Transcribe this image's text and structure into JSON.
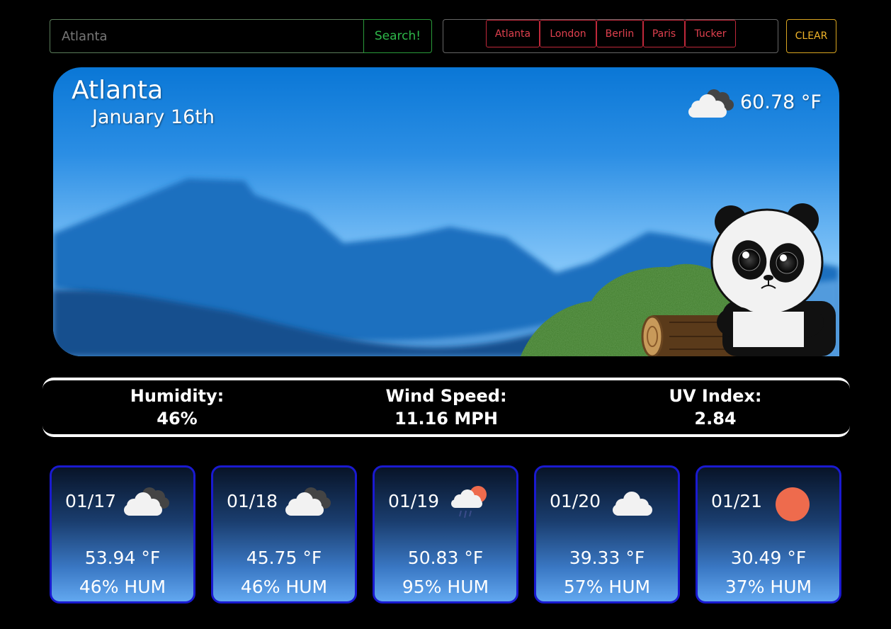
{
  "search": {
    "value": "Atlanta",
    "button_label": "Search!"
  },
  "history": [
    "Atlanta",
    "London",
    "Berlin",
    "Paris",
    "Tucker"
  ],
  "clear_label": "CLEAR",
  "current": {
    "city": "Atlanta",
    "date": "January 16th",
    "temp": "60.78 °F",
    "icon": "partly-cloudy-icon"
  },
  "stats": {
    "humidity_label": "Humidity:",
    "humidity": "46%",
    "wind_label": "Wind Speed:",
    "wind": "11.16 MPH",
    "uv_label": "UV Index:",
    "uv": "2.84"
  },
  "forecast": [
    {
      "date": "01/17",
      "icon": "dark-clouds-icon",
      "temp": "53.94 °F",
      "hum": "46% HUM"
    },
    {
      "date": "01/18",
      "icon": "dark-clouds-icon",
      "temp": "45.75 °F",
      "hum": "46% HUM"
    },
    {
      "date": "01/19",
      "icon": "rain-sun-icon",
      "temp": "50.83 °F",
      "hum": "95% HUM"
    },
    {
      "date": "01/20",
      "icon": "cloud-icon",
      "temp": "39.33 °F",
      "hum": "57% HUM"
    },
    {
      "date": "01/21",
      "icon": "sun-icon",
      "temp": "30.49 °F",
      "hum": "37% HUM"
    }
  ],
  "colors": {
    "search_accent": "#2eb84a",
    "history_accent": "#e0404e",
    "clear_accent": "#f0b429",
    "card_border": "#1a1ad0",
    "sun": "#ee6b4d"
  }
}
